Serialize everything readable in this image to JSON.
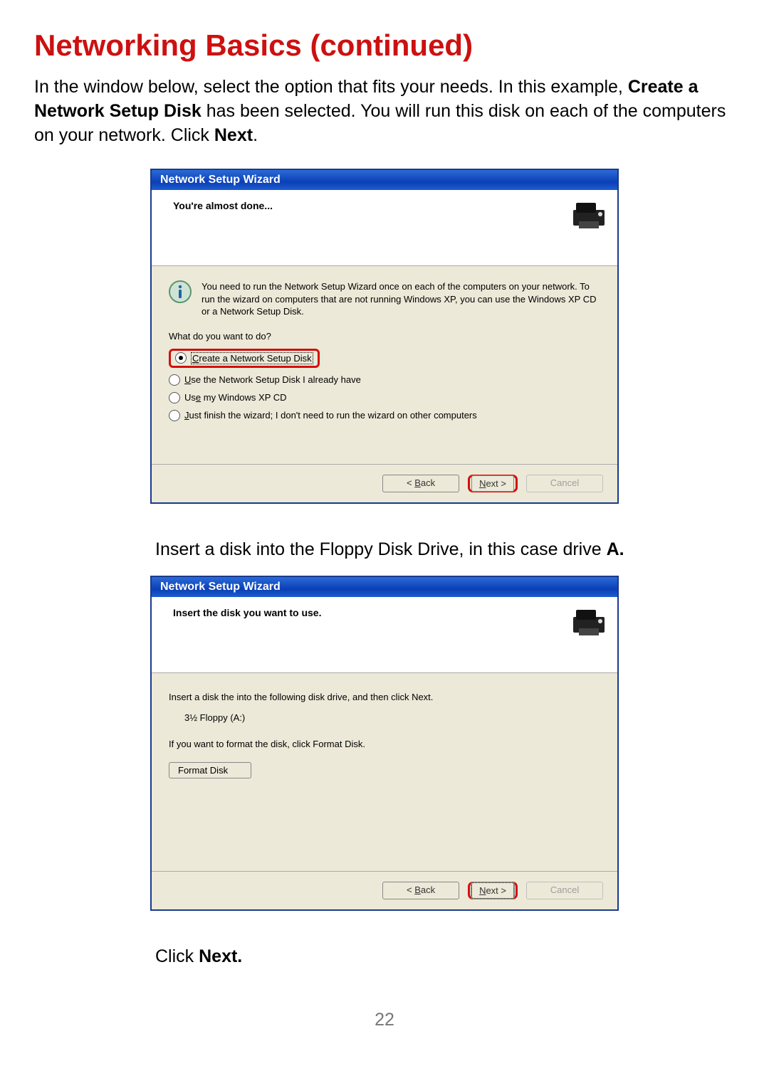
{
  "title": "Networking Basics (continued)",
  "intro_parts": {
    "p1": "In the window below, select the option that fits your needs. In this example, ",
    "b1": "Create a Network Setup Disk",
    "p2": " has been selected. You will run this disk on each of the computers on your network. Click ",
    "b2": "Next",
    "p3": "."
  },
  "dialog1": {
    "title": "Network Setup Wizard",
    "header": "You're almost done...",
    "info": "You need to run the Network Setup Wizard once on each of the computers on your network. To run the wizard on computers that are not running Windows XP, you can use the Windows XP CD or a Network Setup Disk.",
    "prompt": "What do you want to do?",
    "options": {
      "o1": "Create a Network Setup Disk",
      "o2": "Use the Network Setup Disk I already have",
      "o3": "Use my Windows XP CD",
      "o4": "Just finish the wizard; I don't need to run the wizard on other computers"
    },
    "buttons": {
      "back": "< Back",
      "next": "Next >",
      "cancel": "Cancel"
    }
  },
  "mid": {
    "p1": "Insert a disk into the Floppy Disk Drive, in this case drive ",
    "b1": "A.",
    "p2": ""
  },
  "dialog2": {
    "title": "Network Setup Wizard",
    "header": "Insert the disk you want to use.",
    "line1": "Insert a disk the into the following disk drive, and then click Next.",
    "drive": "3½ Floppy (A:)",
    "line2": "If you want to format the disk, click Format Disk.",
    "format": "Format Disk",
    "buttons": {
      "back": "< Back",
      "next": "Next >",
      "cancel": "Cancel"
    }
  },
  "click_next": {
    "p1": "Click ",
    "b1": "Next."
  },
  "page_number": "22"
}
